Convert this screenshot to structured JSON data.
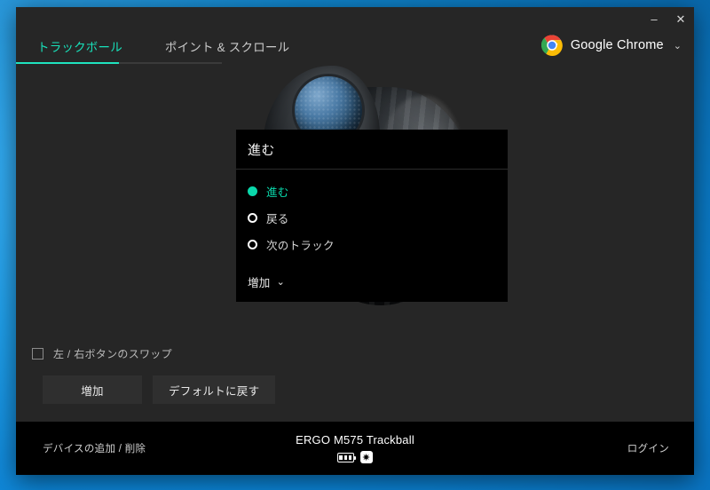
{
  "window": {
    "controls": {
      "minimize": "–",
      "close": "✕"
    }
  },
  "tabs": [
    {
      "label": "トラックボール",
      "active": true
    },
    {
      "label": "ポイント & スクロール",
      "active": false
    }
  ],
  "account": {
    "icon": "chrome-logo-icon",
    "label": "Google Chrome",
    "chevron": "⌄"
  },
  "popover": {
    "title": "進む",
    "options": [
      {
        "label": "進む",
        "selected": true
      },
      {
        "label": "戻る",
        "selected": false
      },
      {
        "label": "次のトラック",
        "selected": false
      }
    ],
    "more_label": "増加",
    "more_chevron": "⌄"
  },
  "stage": {
    "device_image_alt": "ERGO M575 trackball device",
    "swap_checkbox": {
      "label": "左 / 右ボタンのスワップ",
      "checked": false
    },
    "buttons": [
      {
        "label": "増加"
      },
      {
        "label": "デフォルトに戻す"
      }
    ]
  },
  "footer": {
    "add_remove_device": "デバイスの追加 / 削除",
    "device_name": "ERGO M575 Trackball",
    "status_icons": [
      "battery-full-icon",
      "unifying-receiver-icon"
    ],
    "login": "ログイン"
  },
  "colors": {
    "accent": "#1fe3be",
    "accent_radio": "#0ad8ab",
    "window_bg": "#262626",
    "popover_bg": "#000000",
    "footer_bg": "#000000",
    "button_bg": "#2f2f2f",
    "desktop_blue": "#139ae8"
  }
}
